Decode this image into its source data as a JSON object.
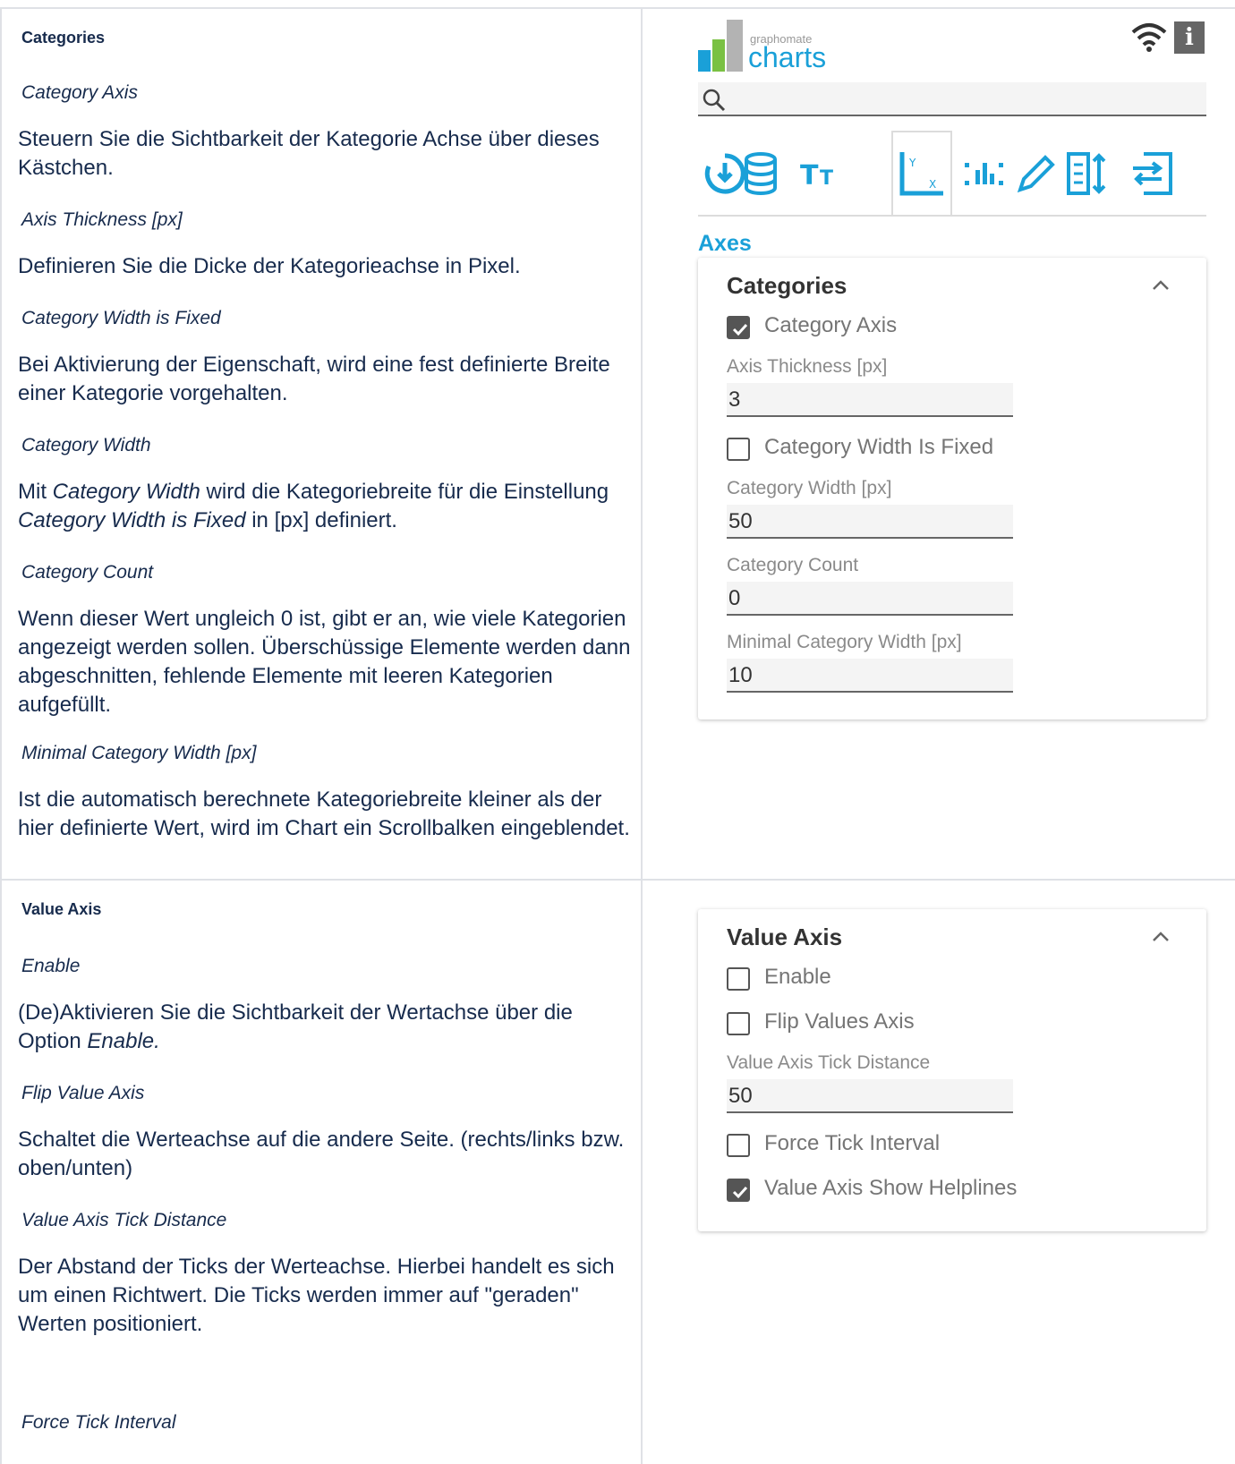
{
  "left": {
    "categories": {
      "title": "Categories",
      "items": [
        {
          "name": "Category Axis",
          "desc_html": "Steuern Sie die Sichtbarkeit der Kategorie Achse über dieses Kästchen."
        },
        {
          "name": "Axis Thickness [px]",
          "desc_html": "Definieren Sie die Dicke der Kategorieachse in Pixel."
        },
        {
          "name": "Category Width is Fixed",
          "desc_html": "Bei Aktivierung der Eigenschaft, wird eine fest definierte Breite einer Kategorie vorgehalten."
        },
        {
          "name": "Category Width",
          "desc_parts": [
            "Mit ",
            "Category Width",
            " wird die Kategoriebreite für die Einstellung ",
            "Category Width is Fixed",
            " in [px] definiert."
          ]
        },
        {
          "name": "Category Count",
          "desc_html": "Wenn dieser Wert ungleich 0 ist, gibt er an, wie viele Kategorien angezeigt werden sollen. Überschüssige Elemente werden dann abgeschnitten, fehlende Elemente mit leeren Kategorien aufgefüllt."
        },
        {
          "name": "Minimal Category Width [px]",
          "desc_html": "Ist die automatisch berechnete Kategoriebreite kleiner als der hier definierte Wert, wird im Chart ein Scrollbalken eingeblendet."
        }
      ]
    },
    "value_axis": {
      "title": "Value Axis",
      "items": [
        {
          "name": "Enable",
          "desc_parts": [
            "(De)Aktivieren Sie die Sichtbarkeit der Wertachse über die Option ",
            "Enable."
          ]
        },
        {
          "name": "Flip Value Axis",
          "desc_html": "Schaltet die Werteachse auf die andere Seite. (rechts/links bzw. oben/unten)"
        },
        {
          "name": "Value Axis Tick Distance",
          "desc_html": "Der Abstand der Ticks der Werteachse. Hierbei handelt es sich um einen Richtwert. Die Ticks werden immer auf \"geraden\" Werten positioniert."
        },
        {
          "name": "Force Tick Interval"
        }
      ]
    }
  },
  "panel": {
    "logo_small": "graphomate",
    "logo_big": "charts",
    "info_glyph": "i",
    "search_placeholder": "",
    "tabs": [
      "reset-icon",
      "database-icon",
      "text-size-icon",
      "axes-icon",
      "data-labels-icon",
      "pen-icon",
      "column-width-icon",
      "legend-icon"
    ],
    "active_tab": "axes-icon",
    "section_title": "Axes",
    "categories_card": {
      "title": "Categories",
      "category_axis": {
        "label": "Category Axis",
        "checked": true
      },
      "axis_thickness": {
        "label": "Axis Thickness [px]",
        "value": "3"
      },
      "width_fixed": {
        "label": "Category Width Is Fixed",
        "checked": false
      },
      "category_width": {
        "label": "Category Width [px]",
        "value": "50"
      },
      "category_count": {
        "label": "Category Count",
        "value": "0"
      },
      "min_width": {
        "label": "Minimal Category Width [px]",
        "value": "10"
      }
    },
    "value_card": {
      "title": "Value Axis",
      "enable": {
        "label": "Enable",
        "checked": false
      },
      "flip": {
        "label": "Flip Values Axis",
        "checked": false
      },
      "tick_distance": {
        "label": "Value Axis Tick Distance",
        "value": "50"
      },
      "force_tick": {
        "label": "Force Tick Interval",
        "checked": false
      },
      "helplines": {
        "label": "Value Axis Show Helplines",
        "checked": true
      }
    },
    "colors": {
      "accent": "#1aa0d8",
      "logo_green": "#7ac143",
      "logo_blue": "#1aa0d8",
      "logo_gray": "#b3b3b3"
    }
  }
}
